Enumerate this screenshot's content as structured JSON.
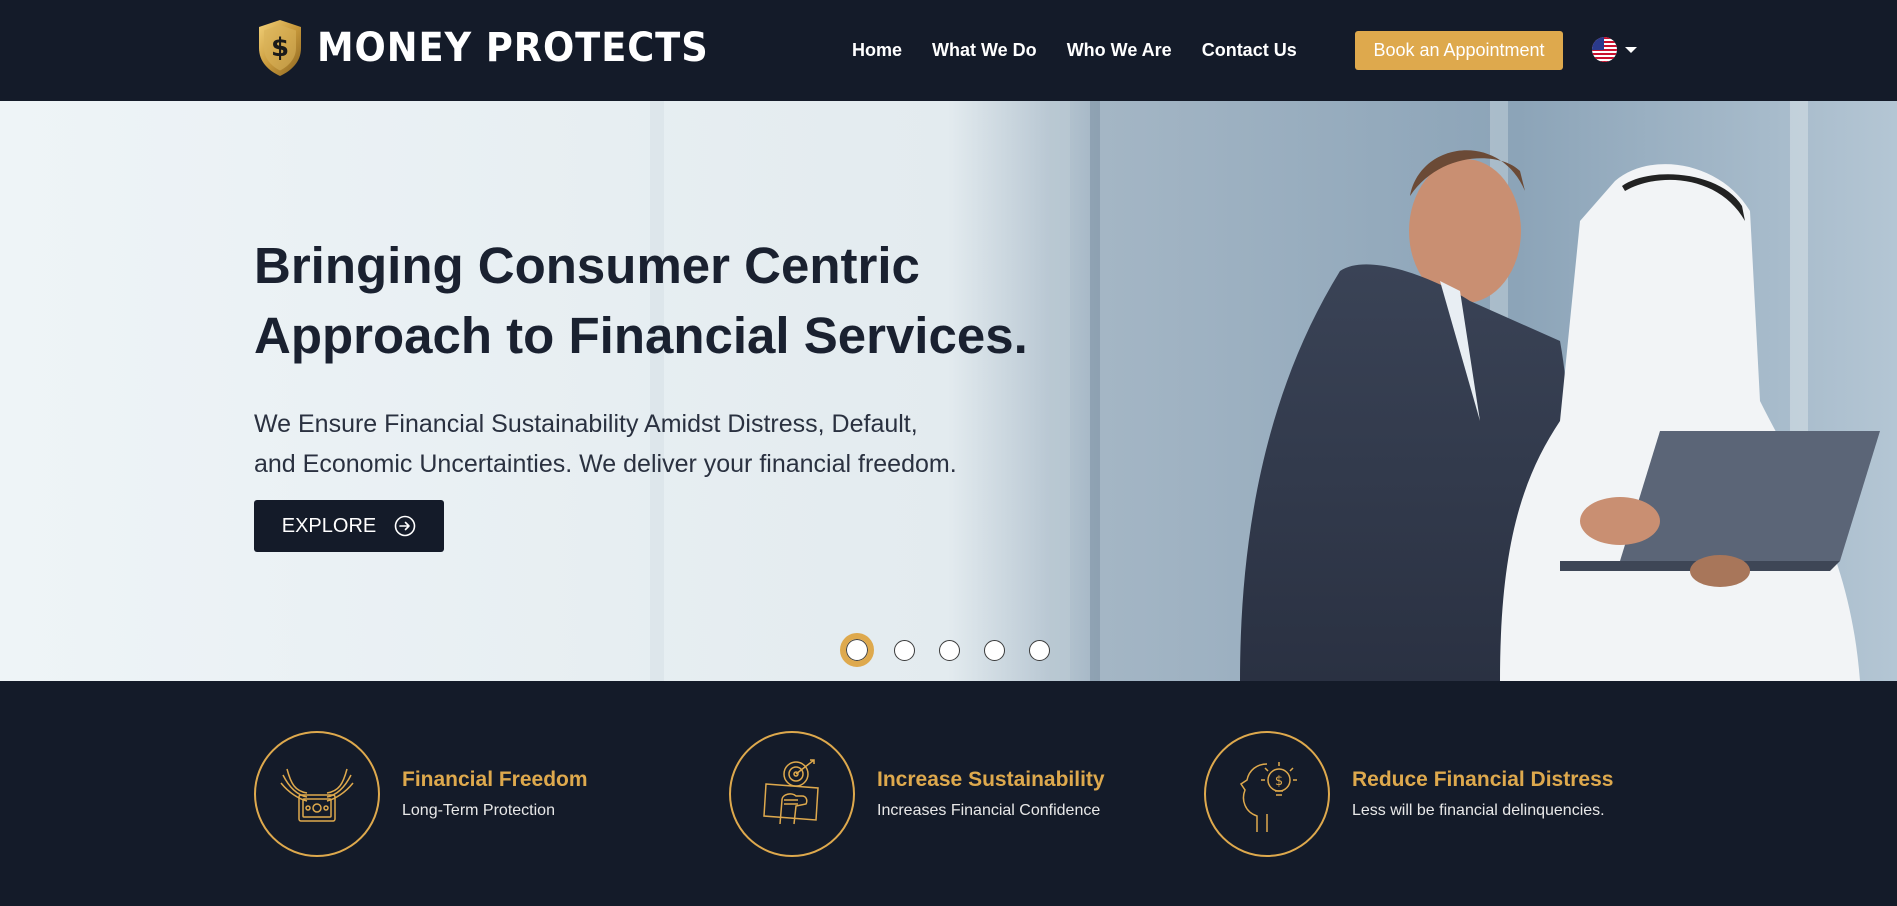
{
  "header": {
    "logo_text": "MONEY PROTECTS",
    "nav": [
      "Home",
      "What We Do",
      "Who We Are",
      "Contact Us"
    ],
    "book_label": "Book an Appointment",
    "language_icon": "us-flag-icon"
  },
  "hero": {
    "title_line1": "Bringing Consumer Centric",
    "title_line2": "Approach to Financial Services.",
    "subtitle_line1": "We Ensure Financial Sustainability Amidst Distress, Default,",
    "subtitle_line2": "and Economic Uncertainties. We deliver your financial freedom.",
    "explore_label": "EXPLORE",
    "slides_total": 5,
    "active_slide": 1
  },
  "features": [
    {
      "title": "Financial Freedom",
      "subtitle": "Long-Term Protection",
      "icon": "winged-money-icon"
    },
    {
      "title": "Increase Sustainability",
      "subtitle": "Increases Financial Confidence",
      "icon": "target-fist-icon"
    },
    {
      "title": "Reduce Financial Distress",
      "subtitle": "Less will be financial delinquencies.",
      "icon": "head-idea-icon"
    }
  ],
  "colors": {
    "navy": "#141b29",
    "gold": "#dea94d",
    "white": "#ffffff"
  }
}
